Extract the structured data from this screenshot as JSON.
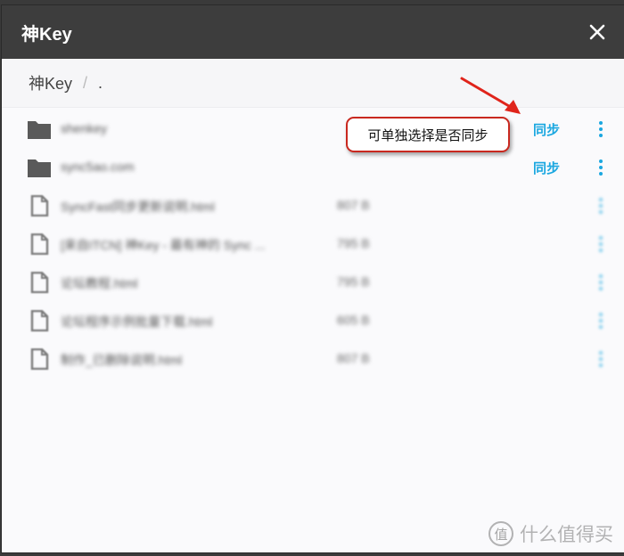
{
  "header": {
    "title": "神Key"
  },
  "breadcrumb": {
    "root": "神Key",
    "separator": "/",
    "current": "."
  },
  "items": [
    {
      "kind": "folder",
      "name": "shenkey",
      "size": "",
      "sync_label": "同步"
    },
    {
      "kind": "folder",
      "name": "sync5ao.com",
      "size": "",
      "sync_label": "同步"
    },
    {
      "kind": "file",
      "name": "SyncFast同步更新说明.html",
      "size": "807 B",
      "sync_label": ""
    },
    {
      "kind": "file",
      "name": "[来自ITCN] 神Key - 最有神的 Sync ...",
      "size": "795 B",
      "sync_label": ""
    },
    {
      "kind": "file",
      "name": "论坛教程.html",
      "size": "795 B",
      "sync_label": ""
    },
    {
      "kind": "file",
      "name": "论坛程序示例批量下载.html",
      "size": "605 B",
      "sync_label": ""
    },
    {
      "kind": "file",
      "name": "制作_已删除说明.html",
      "size": "807 B",
      "sync_label": ""
    }
  ],
  "callout": {
    "text": "可单独选择是否同步"
  },
  "watermark": {
    "text": "什么值得买",
    "badge": "值"
  },
  "colors": {
    "header_bg": "#3d3d3d",
    "accent": "#1aa7e0",
    "callout_border": "#c9281f",
    "arrow": "#e0241b"
  }
}
